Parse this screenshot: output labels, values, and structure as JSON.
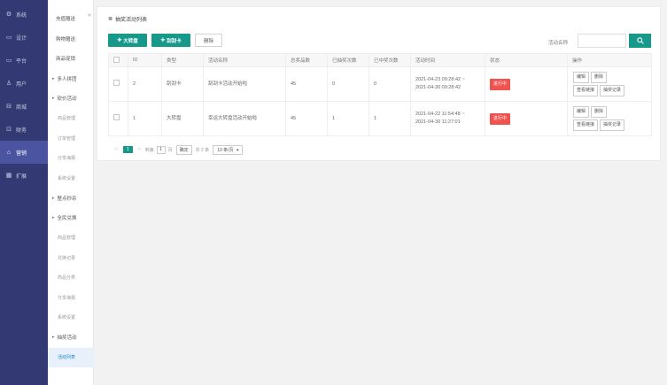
{
  "nav": {
    "items": [
      {
        "icon": "gear-icon",
        "glyph": "⚙",
        "label": "系统"
      },
      {
        "icon": "monitor-icon",
        "glyph": "▭",
        "label": "设计"
      },
      {
        "icon": "desktop-icon",
        "glyph": "▭",
        "label": "平台"
      },
      {
        "icon": "user-icon",
        "glyph": "♙",
        "label": "用户"
      },
      {
        "icon": "shop-icon",
        "glyph": "⊟",
        "label": "商城"
      },
      {
        "icon": "finance-icon",
        "glyph": "⊡",
        "label": "财务"
      },
      {
        "icon": "marketing-icon",
        "glyph": "⌂",
        "label": "营销"
      },
      {
        "icon": "extend-icon",
        "glyph": "▦",
        "label": "扩展"
      }
    ],
    "active_index": 6
  },
  "submenu": {
    "collapse_glyph": "«",
    "items": [
      {
        "label": "充值赠送",
        "kind": "top"
      },
      {
        "label": "购物赠送",
        "kind": "top"
      },
      {
        "label": "商品促销",
        "kind": "top"
      },
      {
        "label": "多人拼团",
        "kind": "group"
      },
      {
        "label": "砍价活动",
        "kind": "group"
      },
      {
        "label": "商品管理",
        "kind": "child"
      },
      {
        "label": "订单管理",
        "kind": "child"
      },
      {
        "label": "分享海报",
        "kind": "child"
      },
      {
        "label": "系统设置",
        "kind": "child"
      },
      {
        "label": "整点秒杀",
        "kind": "group"
      },
      {
        "label": "全民兑换",
        "kind": "group"
      },
      {
        "label": "商品管理",
        "kind": "child"
      },
      {
        "label": "兑换记录",
        "kind": "child"
      },
      {
        "label": "商品分类",
        "kind": "child"
      },
      {
        "label": "分享海报",
        "kind": "child"
      },
      {
        "label": "系统设置",
        "kind": "child"
      },
      {
        "label": "抽奖活动",
        "kind": "group"
      },
      {
        "label": "活动列表",
        "kind": "child",
        "active": true
      }
    ]
  },
  "panel": {
    "title": "抽奖活动列表",
    "title_icon": "≣"
  },
  "toolbar": {
    "wheel_label": "大转盘",
    "scratch_label": "刮刮卡",
    "delete_label": "删除"
  },
  "search": {
    "label": "活动名称",
    "value": "",
    "placeholder": ""
  },
  "table": {
    "headers": [
      "",
      "ID",
      "类型",
      "活动名称",
      "总奖品数",
      "已抽奖次数",
      "已中奖次数",
      "活动时间",
      "状态",
      "操作"
    ],
    "rows": [
      {
        "id": "2",
        "type": "刮刮卡",
        "name": "刮刮卡活动开始啦",
        "total": "45",
        "drawn": "0",
        "won": "0",
        "time_start": "2021-04-23 09:28:42 ~",
        "time_end": "2021-04-30 09:28:42",
        "status": "进行中",
        "ops": [
          "编辑",
          "删除",
          "查看链接",
          "抽奖记录"
        ]
      },
      {
        "id": "1",
        "type": "大转盘",
        "name": "幸运大转盘活动开始啦",
        "total": "45",
        "drawn": "1",
        "won": "1",
        "time_start": "2021-04-22 11:54:48 ~",
        "time_end": "2021-04-30 11:27:01",
        "status": "进行中",
        "ops": [
          "编辑",
          "删除",
          "查看链接",
          "抽奖记录"
        ]
      }
    ]
  },
  "pager": {
    "prev": "<",
    "page": "1",
    "next": ">",
    "goto_label": "到第",
    "goto_value": "1",
    "page_unit": "页",
    "confirm": "确定",
    "total": "共 2 条",
    "page_size": "10 条/页",
    "size_arrow": "▾"
  },
  "colors": {
    "sidebar": "#333a73",
    "accent": "#16998a",
    "status": "#ef5350"
  }
}
